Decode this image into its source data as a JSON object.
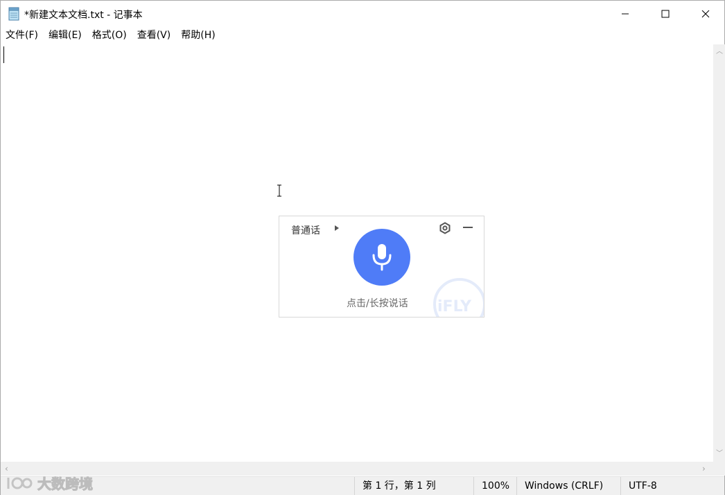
{
  "window": {
    "title": "*新建文本文档.txt - 记事本"
  },
  "menu": {
    "items": [
      "文件(F)",
      "编辑(E)",
      "格式(O)",
      "查看(V)",
      "帮助(H)"
    ]
  },
  "icons": {
    "app": "notepad-icon",
    "minimize": "minimize-icon",
    "maximize": "maximize-icon",
    "close": "close-icon",
    "gear": "settings-icon",
    "mic": "microphone-icon"
  },
  "voice_input": {
    "language": "普通话",
    "hint": "点击/长按说话",
    "logo_text": "iFLY",
    "accent_color": "#4f7cf7"
  },
  "status": {
    "position": "第 1 行，第 1 列",
    "zoom": "100%",
    "line_ending": "Windows (CRLF)",
    "encoding": "UTF-8"
  },
  "watermark": {
    "text": "大数跨境"
  }
}
